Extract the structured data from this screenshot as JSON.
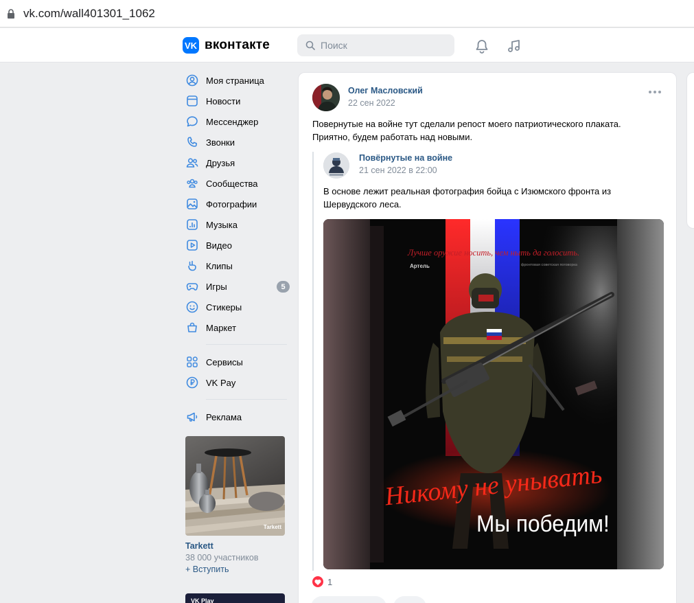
{
  "browser": {
    "url": "vk.com/wall401301_1062"
  },
  "header": {
    "logo_mark": "VK",
    "logo_text": "вконтакте",
    "search_placeholder": "Поиск"
  },
  "sidebar": {
    "items": [
      {
        "label": "Моя страница",
        "icon": "user-icon"
      },
      {
        "label": "Новости",
        "icon": "news-icon"
      },
      {
        "label": "Мессенджер",
        "icon": "message-icon"
      },
      {
        "label": "Звонки",
        "icon": "phone-icon"
      },
      {
        "label": "Друзья",
        "icon": "friends-icon"
      },
      {
        "label": "Сообщества",
        "icon": "communities-icon"
      },
      {
        "label": "Фотографии",
        "icon": "photos-icon"
      },
      {
        "label": "Музыка",
        "icon": "music-icon"
      },
      {
        "label": "Видео",
        "icon": "video-icon"
      },
      {
        "label": "Клипы",
        "icon": "clips-icon"
      },
      {
        "label": "Игры",
        "icon": "games-icon",
        "badge": "5"
      },
      {
        "label": "Стикеры",
        "icon": "stickers-icon"
      },
      {
        "label": "Маркет",
        "icon": "market-icon"
      }
    ],
    "items2": [
      {
        "label": "Сервисы",
        "icon": "services-icon"
      },
      {
        "label": "VK Pay",
        "icon": "vkpay-icon"
      }
    ],
    "items3": [
      {
        "label": "Реклама",
        "icon": "ads-icon"
      }
    ]
  },
  "ad": {
    "brand_on_image": "Tarkett",
    "name": "Tarkett",
    "members": "38 000 участников",
    "join": "+ Вступить",
    "second_ad_text": "VK Play"
  },
  "post": {
    "author": "Олег Масловский",
    "date": "22 сен 2022",
    "text": "Повернутые на войне тут сделали репост моего патриотического плаката. Приятно, будем работать над новыми.",
    "repost": {
      "author": "Повёрнутые на войне",
      "date": "21 сен 2022 в 22:00",
      "text": "В основе лежит реальная фотография бойца с Изюмского фронта из Шервудского леса.",
      "poster": {
        "top_quote": "Лучше оружие носить, чем ныть да голосить.",
        "signature": "Артель",
        "proverb_source": "фронтовая советская поговорка",
        "slogan": "Никому не унывать",
        "headline": "Мы победим!"
      }
    },
    "likes_count": "1"
  },
  "colors": {
    "accent": "#0077ff",
    "link": "#2a5885",
    "muted": "#818c99",
    "background": "#edeef0",
    "like": "#ff3347"
  }
}
